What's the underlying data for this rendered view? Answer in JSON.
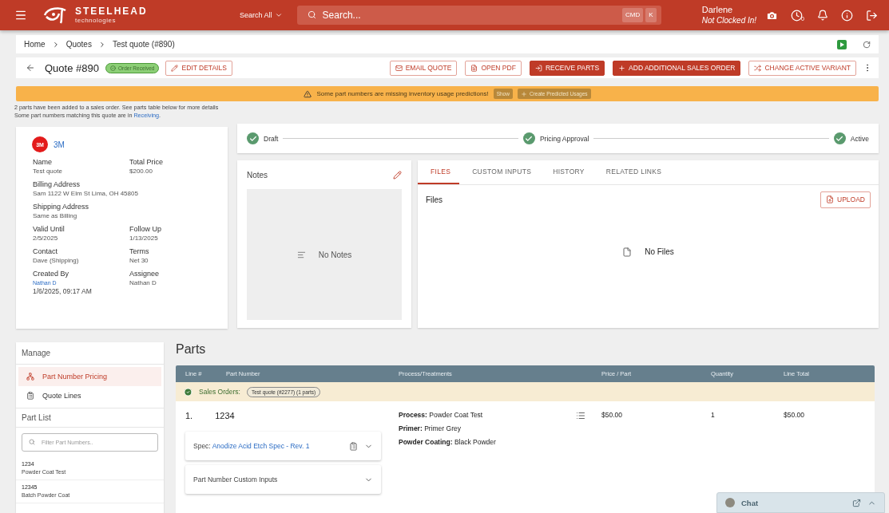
{
  "header": {
    "brand": "STEELHEAD",
    "tagline": "technologies",
    "search_scope": "Search All",
    "search_placeholder": "Search...",
    "shortcut_keys": [
      "CMD",
      "K"
    ],
    "user_name": "Darlene",
    "user_status": "Not Clocked In!",
    "clock_count": "0"
  },
  "breadcrumbs": [
    {
      "label": "Home"
    },
    {
      "label": "Quotes"
    },
    {
      "label": "Test quote (#890)"
    }
  ],
  "quote": {
    "title": "Quote #890",
    "status": "Order Received",
    "edit_label": "EDIT DETAILS",
    "actions": [
      {
        "label": "EMAIL QUOTE",
        "kind": "outline"
      },
      {
        "label": "OPEN PDF",
        "kind": "outline"
      },
      {
        "label": "RECEIVE PARTS",
        "kind": "filled"
      },
      {
        "label": "ADD ADDITIONAL SALES ORDER",
        "kind": "filled"
      },
      {
        "label": "CHANGE ACTIVE VARIANT",
        "kind": "outline"
      }
    ]
  },
  "alert": {
    "message": "Some part numbers are missing inventory usage predictions!",
    "show_label": "Show",
    "create_label": "Create Predicted Usages"
  },
  "notices": [
    {
      "text": "2 parts have been added to a sales order. See parts table below for more details"
    },
    {
      "text": "Some part numbers matching this quote are in ",
      "link": "Receiving",
      "after": "."
    }
  ],
  "customer": {
    "logo": "3M",
    "name": "3M",
    "fields": [
      {
        "kind": "half",
        "label": "Name",
        "value": "Test quote"
      },
      {
        "kind": "half",
        "label": "Total Price",
        "value": "$200.00"
      },
      {
        "kind": "wide",
        "label": "Billing Address",
        "value": "Sam 1122 W Elm St Lima, OH 45805"
      },
      {
        "kind": "wide",
        "label": "Shipping Address",
        "value": "Same as Billing"
      },
      {
        "kind": "half",
        "label": "Valid Until",
        "value": "2/5/2025"
      },
      {
        "kind": "half",
        "label": "Follow Up",
        "value": "1/13/2025"
      },
      {
        "kind": "half",
        "label": "Contact",
        "value": "Dave (Shipping)"
      },
      {
        "kind": "half",
        "label": "Terms",
        "value": "Net 30"
      },
      {
        "kind": "link",
        "label": "Created By",
        "value": "Nathan D",
        "note": "1/6/2025, 09:17 AM"
      },
      {
        "kind": "half",
        "label": "Assignee",
        "value": "Nathan D"
      }
    ]
  },
  "steps": [
    {
      "label": "Draft",
      "done": true
    },
    {
      "label": "Pricing Approval",
      "done": true
    },
    {
      "label": "Active",
      "done": true
    }
  ],
  "notes": {
    "title": "Notes",
    "empty": "No Notes"
  },
  "tabs": [
    {
      "label": "FILES",
      "selected": true
    },
    {
      "label": "CUSTOM INPUTS",
      "selected": false
    },
    {
      "label": "HISTORY",
      "selected": false
    },
    {
      "label": "RELATED LINKS",
      "selected": false
    }
  ],
  "files": {
    "title": "Files",
    "upload_label": "UPLOAD",
    "empty": "No Files"
  },
  "manage": {
    "title": "Manage",
    "items": [
      {
        "label": "Part Number Pricing",
        "selected": true
      },
      {
        "label": "Quote Lines",
        "selected": false
      }
    ]
  },
  "part_list": {
    "title": "Part List",
    "placeholder": "Filter Part Numbers..",
    "items": [
      {
        "number": "1234",
        "process": "Powder Coat Test"
      },
      {
        "number": "12345",
        "process": "Batch Powder Coat"
      }
    ]
  },
  "parts": {
    "title": "Parts",
    "columns": [
      "Line #",
      "Part Number",
      "Process/Treatments",
      "Price / Part",
      "Quantity",
      "Line Total"
    ],
    "sales_orders_label": "Sales Orders:",
    "sales_order_chip": "Test quote (#2277) (1 parts)",
    "lines": [
      {
        "line": "1.",
        "part": "1234",
        "spec_label": "Spec:",
        "spec": "Anodize Acid Etch Spec - Rev. 1",
        "custom_inputs": "Part Number Custom Inputs",
        "treatments": [
          {
            "label": "Process:",
            "value": "Powder Coat Test"
          },
          {
            "label": "Primer:",
            "value": "Primer Grey"
          },
          {
            "label": "Powder Coating:",
            "value": "Black Powder"
          }
        ],
        "price": "$50.00",
        "quantity": "1",
        "total": "$50.00"
      }
    ]
  },
  "chat": {
    "label": "Chat"
  }
}
